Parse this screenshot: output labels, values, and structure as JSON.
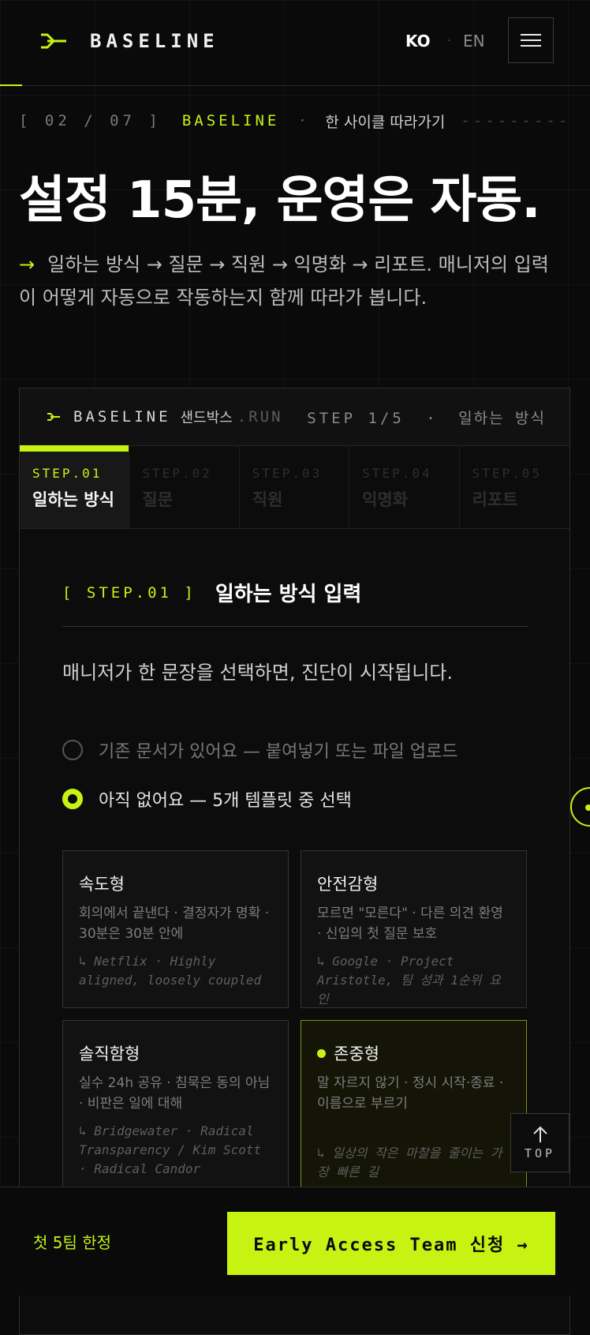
{
  "header": {
    "logo_text": "BASELINE",
    "lang_ko": "KO",
    "lang_sep": "·",
    "lang_en": "EN"
  },
  "crumb": {
    "index": "[ 02 / 07 ]",
    "brand": "BASELINE",
    "dot": "·",
    "title": "한 사이클 따라가기",
    "dashes": "---------"
  },
  "hero": {
    "title": "설정 15분, 운영은 자동.",
    "arrow": "→",
    "description": "일하는 방식 → 질문 → 직원 → 익명화 → 리포트. 매니저의 입력이 어떻게 자동으로 작동하는지 함께 따라가 봅니다."
  },
  "sandbox": {
    "brand": "BASELINE",
    "label": "샌드박스",
    "run": ".RUN",
    "step_indicator": "STEP 1/5",
    "step_dot": "·",
    "step_label": "일하는 방식",
    "tabs": [
      {
        "num": "STEP.01",
        "label": "일하는 방식",
        "active": true
      },
      {
        "num": "STEP.02",
        "label": "질문",
        "active": false
      },
      {
        "num": "STEP.03",
        "label": "직원",
        "active": false
      },
      {
        "num": "STEP.04",
        "label": "익명화",
        "active": false
      },
      {
        "num": "STEP.05",
        "label": "리포트",
        "active": false
      }
    ],
    "step_tag": "[ STEP.01 ]",
    "step_title": "일하는 방식 입력",
    "step_desc": "매니저가 한 문장을 선택하면, 진단이 시작됩니다.",
    "options": [
      {
        "label": "기존 문서가 있어요 — 붙여넣기 또는 파일 업로드",
        "selected": false
      },
      {
        "label": "아직 없어요 — 5개 템플릿 중 선택",
        "selected": true
      }
    ],
    "templates": [
      {
        "name": "속도형",
        "desc": "회의에서 끝낸다 · 결정자가 명확 · 30분은 30분 안에",
        "ref": "↳ Netflix · Highly aligned, loosely coupled",
        "selected": false
      },
      {
        "name": "안전감형",
        "desc": "모르면 \"모른다\" · 다른 의견 환영 · 신입의 첫 질문 보호",
        "ref": "↳ Google · Project Aristotle, 팀 성과 1순위 요인",
        "selected": false
      },
      {
        "name": "솔직함형",
        "desc": "실수 24h 공유 · 침묵은 동의 아님 · 비판은 일에 대해",
        "ref": "↳ Bridgewater · Radical Transparency / Kim Scott · Radical Candor",
        "selected": false
      },
      {
        "name": "존중형",
        "desc": "말 자르지 않기 · 정시 시작·종료 · 이름으로 부르기",
        "ref": "↳ 일상의 작은 마찰을 줄이는 가장 빠른 길",
        "selected": true
      }
    ]
  },
  "top_button": {
    "label": "TOP"
  },
  "bottom": {
    "note": "첫 5팀 한정",
    "cta": "Early Access Team 신청 →"
  },
  "colors": {
    "accent": "#c6f312",
    "background": "#0a0a0a"
  }
}
